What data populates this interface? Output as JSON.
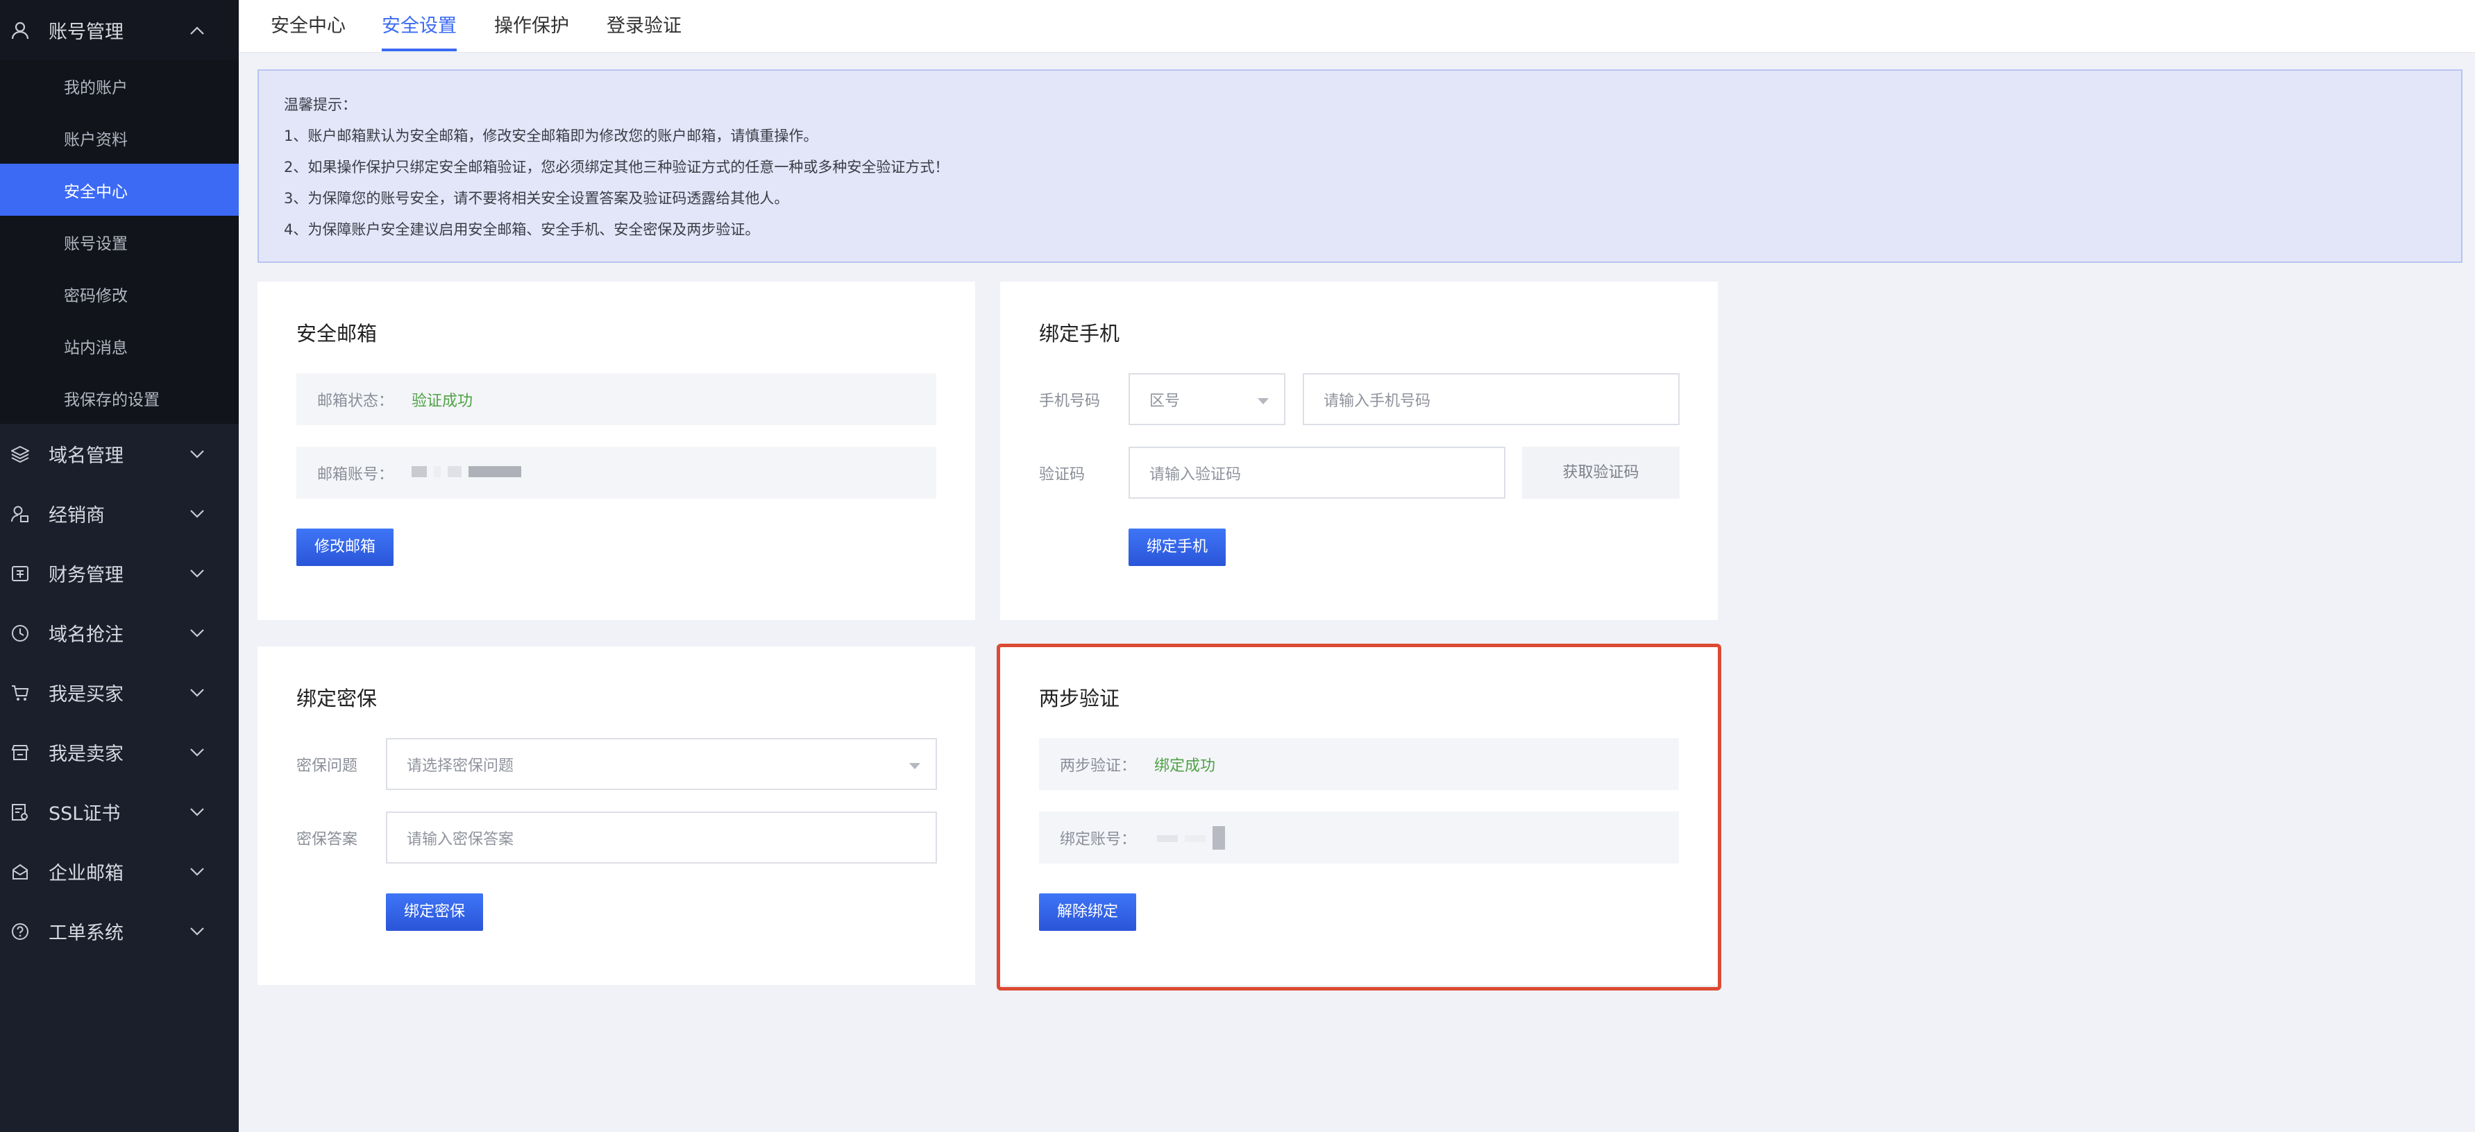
{
  "sidebar": {
    "account_group": {
      "label": "账号管理",
      "items": [
        {
          "label": "我的账户"
        },
        {
          "label": "账户资料"
        },
        {
          "label": "安全中心"
        },
        {
          "label": "账号设置"
        },
        {
          "label": "密码修改"
        },
        {
          "label": "站内消息"
        },
        {
          "label": "我保存的设置"
        }
      ]
    },
    "groups": [
      {
        "label": "域名管理"
      },
      {
        "label": "经销商"
      },
      {
        "label": "财务管理"
      },
      {
        "label": "域名抢注"
      },
      {
        "label": "我是买家"
      },
      {
        "label": "我是卖家"
      },
      {
        "label": "SSL证书"
      },
      {
        "label": "企业邮箱"
      },
      {
        "label": "工单系统"
      }
    ]
  },
  "tabs": [
    {
      "label": "安全中心"
    },
    {
      "label": "安全设置"
    },
    {
      "label": "操作保护"
    },
    {
      "label": "登录验证"
    }
  ],
  "notice": {
    "title": "温馨提示：",
    "lines": [
      "1、账户邮箱默认为安全邮箱，修改安全邮箱即为修改您的账户邮箱，请慎重操作。",
      "2、如果操作保护只绑定安全邮箱验证，您必须绑定其他三种验证方式的任意一种或多种安全验证方式！",
      "3、为保障您的账号安全，请不要将相关安全设置答案及验证码透露给其他人。",
      "4、为保障账户安全建议启用安全邮箱、安全手机、安全密保及两步验证。"
    ]
  },
  "email_card": {
    "title": "安全邮箱",
    "status_label": "邮箱状态：",
    "status_value": "验证成功",
    "account_label": "邮箱账号：",
    "button": "修改邮箱"
  },
  "phone_card": {
    "title": "绑定手机",
    "phone_label": "手机号码",
    "area_placeholder": "区号",
    "phone_placeholder": "请输入手机号码",
    "code_label": "验证码",
    "code_placeholder": "请输入验证码",
    "get_code": "获取验证码",
    "button": "绑定手机"
  },
  "security_card": {
    "title": "绑定密保",
    "question_label": "密保问题",
    "question_placeholder": "请选择密保问题",
    "answer_label": "密保答案",
    "answer_placeholder": "请输入密保答案",
    "button": "绑定密保"
  },
  "twostep_card": {
    "title": "两步验证",
    "status_label": "两步验证：",
    "status_value": "绑定成功",
    "account_label": "绑定账号：",
    "button": "解除绑定"
  },
  "colors": {
    "accent": "#3b6af2",
    "success": "#4ea245",
    "highlight": "#dc4a33",
    "sidebar_bg": "#1b1f2b"
  }
}
